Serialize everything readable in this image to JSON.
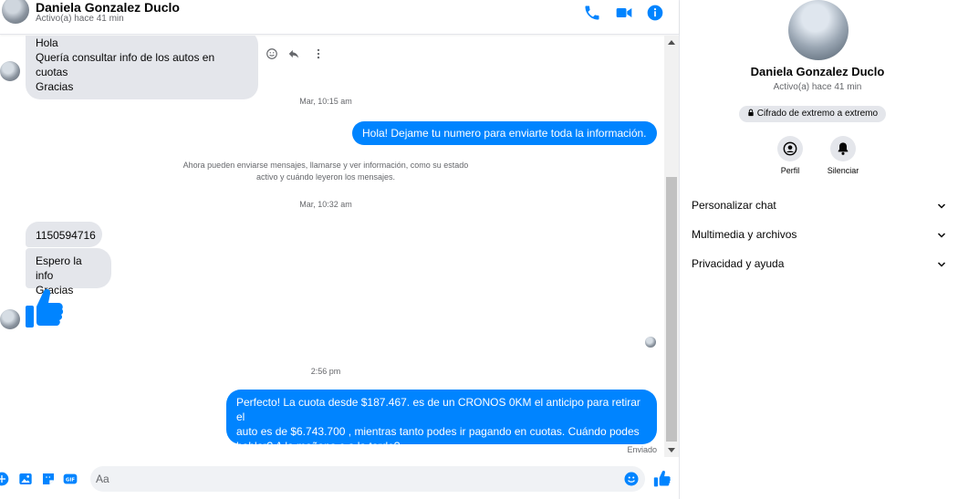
{
  "contact": {
    "name": "Daniela Gonzalez Duclo",
    "status": "Activo(a) hace 41 min"
  },
  "header_icons": [
    "phone-icon",
    "video-icon",
    "info-icon"
  ],
  "messages": {
    "m1_line1": "Hola",
    "m1_line2": "Quería consultar info de los autos en cuotas",
    "m1_line3": "Gracias",
    "stamp1": "Mar, 10:15 am",
    "out1": "Hola! Dejame tu numero  para enviarte toda la información.",
    "sys_line1": "Ahora pueden enviarse mensajes, llamarse y ver información, como su estado",
    "sys_line2": "activo y cuándo leyeron los mensajes.",
    "stamp2": "Mar, 10:32 am",
    "in2": "1150594716",
    "in3_line1": "Espero la info",
    "in3_line2": "Gracias",
    "stamp3": "2:56 pm",
    "out2_line1": "Perfecto! La cuota desde $187.467. es de un CRONOS 0KM el anticipo para retirar el",
    "out2_line2": "auto es de $6.743.700 , mientras tanto podes ir pagando en cuotas. Cuándo podes",
    "out2_line3": "hablar? A la mañana o a la tarde?",
    "sent_status": "Enviado"
  },
  "composer": {
    "placeholder": "Aa"
  },
  "side": {
    "name": "Daniela Gonzalez Duclo",
    "status": "Activo(a) hace 41 min",
    "encryption": "Cifrado de extremo a extremo",
    "profile_label": "Perfil",
    "mute_label": "Silenciar",
    "sections": [
      "Personalizar chat",
      "Multimedia y archivos",
      "Privacidad y ayuda"
    ]
  },
  "colors": {
    "accent": "#0084ff",
    "incoming_bubble": "#e4e6eb",
    "secondary_text": "#65676b"
  }
}
